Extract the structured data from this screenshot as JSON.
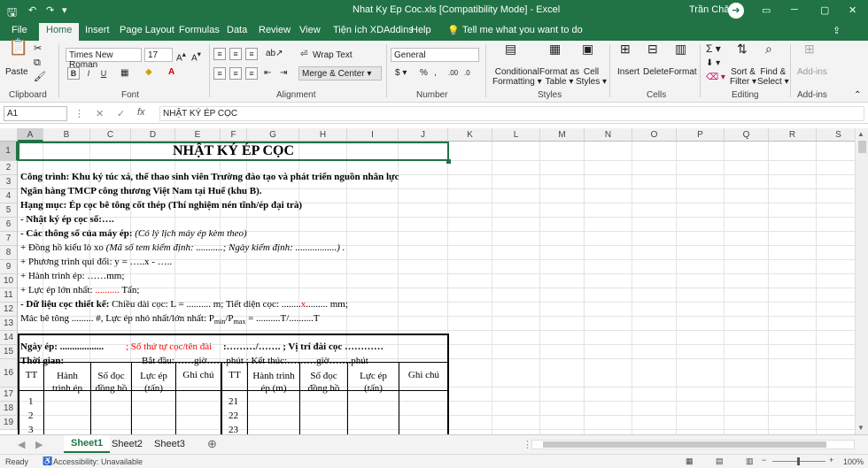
{
  "titlebar": {
    "title": "Nhat Ky Ep Coc.xls  [Compatibility Mode]  -  Excel",
    "user": "Trần Châu",
    "initial": "➔"
  },
  "tabs": [
    "File",
    "Home",
    "Insert",
    "Page Layout",
    "Formulas",
    "Data",
    "Review",
    "View",
    "Tiện ích XDAddins",
    "Help"
  ],
  "tellme": "Tell me what you want to do",
  "ribbon": {
    "paste": "Paste",
    "clipboard": "Clipboard",
    "font_name": "Times New Roman",
    "font_size": "17",
    "font_group": "Font",
    "bold": "B",
    "italic": "I",
    "underline": "U",
    "wrap": "Wrap Text",
    "merge": "Merge & Center",
    "alignment": "Alignment",
    "number_format": "General",
    "number": "Number",
    "pct": "%",
    "comma": ",",
    "cond1": "Conditional",
    "cond2": "Formatting",
    "fmt_table1": "Format as",
    "fmt_table2": "Table",
    "cell_styles1": "Cell",
    "cell_styles2": "Styles",
    "styles": "Styles",
    "insert": "Insert",
    "delete": "Delete",
    "format": "Format",
    "cells": "Cells",
    "sort1": "Sort &",
    "sort2": "Filter",
    "find1": "Find &",
    "find2": "Select",
    "editing": "Editing",
    "addins": "Add-ins",
    "addins_group": "Add-ins"
  },
  "formula": {
    "namebox": "A1",
    "fx": "fx",
    "content": "NHẬT KÝ ÉP CỌC"
  },
  "columns": [
    "A",
    "B",
    "C",
    "D",
    "E",
    "F",
    "G",
    "H",
    "I",
    "J",
    "K",
    "L",
    "M",
    "N",
    "O",
    "P",
    "Q",
    "R",
    "S"
  ],
  "rows": [
    "1",
    "2",
    "3",
    "4",
    "5",
    "6",
    "7",
    "8",
    "9",
    "10",
    "11",
    "12",
    "13",
    "14",
    "15",
    "16",
    "17",
    "18",
    "19"
  ],
  "sheet": {
    "r1": "NHẬT KÝ ÉP CỌC",
    "r2": "Công trình:  Khu ký túc xá, thể thao sinh viên Trường đào tạo và phát triển nguồn nhân lực",
    "r3": "Ngân hàng TMCP công thương Việt Nam tại Huế (khu B).",
    "r4": "Hạng mục: Ép cọc bê tông cốt thép (Thí nghiệm nén tĩnh/ép đại trà)",
    "r5": "- Nhật ký ép cọc số:….",
    "r6a": "- Các thông số của máy ép:",
    "r6b": " (Có lý lịch máy ép kèm theo)",
    "r7a": "+ Đồng hồ kiểu lò xo",
    "r7b": " (Mã số tem kiểm định: ...........; Ngày kiểm định: .................) .",
    "r8": "+ Phương trình qui đổi: y = …..x - …..",
    "r9": "+ Hành trình ép: ……mm;",
    "r10a": "+ Lực ép lớn nhất: ",
    "r10b": "..........",
    "r10c": " Tấn;",
    "r11a": "- Dữ liệu cọc thiết kế:",
    "r11b": " Chiều dài cọc: L = .......... m; Tiết diện cọc: ........",
    "r11c": "x",
    "r11d": "......... mm;",
    "r12a": "Mác bê tông ......... #, Lực ép nhỏ nhất/lớn nhất: P",
    "r12b": "min",
    "r12c": "/P",
    "r12d": "max",
    "r12e": " = ..........T/..........T",
    "r14a": "Ngày ép: ..................",
    "r14b": "; Số thứ tự cọc/tên đài",
    "r14c": " :………/……. ; Vị trí đài cọc …………",
    "r15a": "Thời gian:",
    "r15b": "Bắt đầu:……giờ……phút ;     Kết thúc:………giờ…….phút",
    "h_tt": "TT",
    "h_hanh1": "Hành",
    "h_hanh2": "trình ép",
    "h_so1": "Số đọc",
    "h_so2": "đồng hồ",
    "h_luc1": "Lực ép",
    "h_luc2": "(tấn)",
    "h_ghi": "Ghi chú",
    "h_tt2": "TT",
    "h_hanh3": "Hành trình",
    "h_hanh4": "ép (m)",
    "h_so3": "Số đọc",
    "h_so4": "đồng hồ",
    "h_luc3": "Lực ép",
    "h_luc4": "(tấn)",
    "h_ghi2": "Ghi chú",
    "n1": "1",
    "n2": "2",
    "n3": "3",
    "n21": "21",
    "n22": "22",
    "n23": "23"
  },
  "sheettabs": [
    "Sheet1",
    "Sheet2",
    "Sheet3"
  ],
  "status": {
    "ready": "Ready",
    "access": "Accessibility: Unavailable",
    "zoom": "100%"
  },
  "colors": {
    "excel_green": "#217346",
    "red_text": "#ff0000"
  }
}
